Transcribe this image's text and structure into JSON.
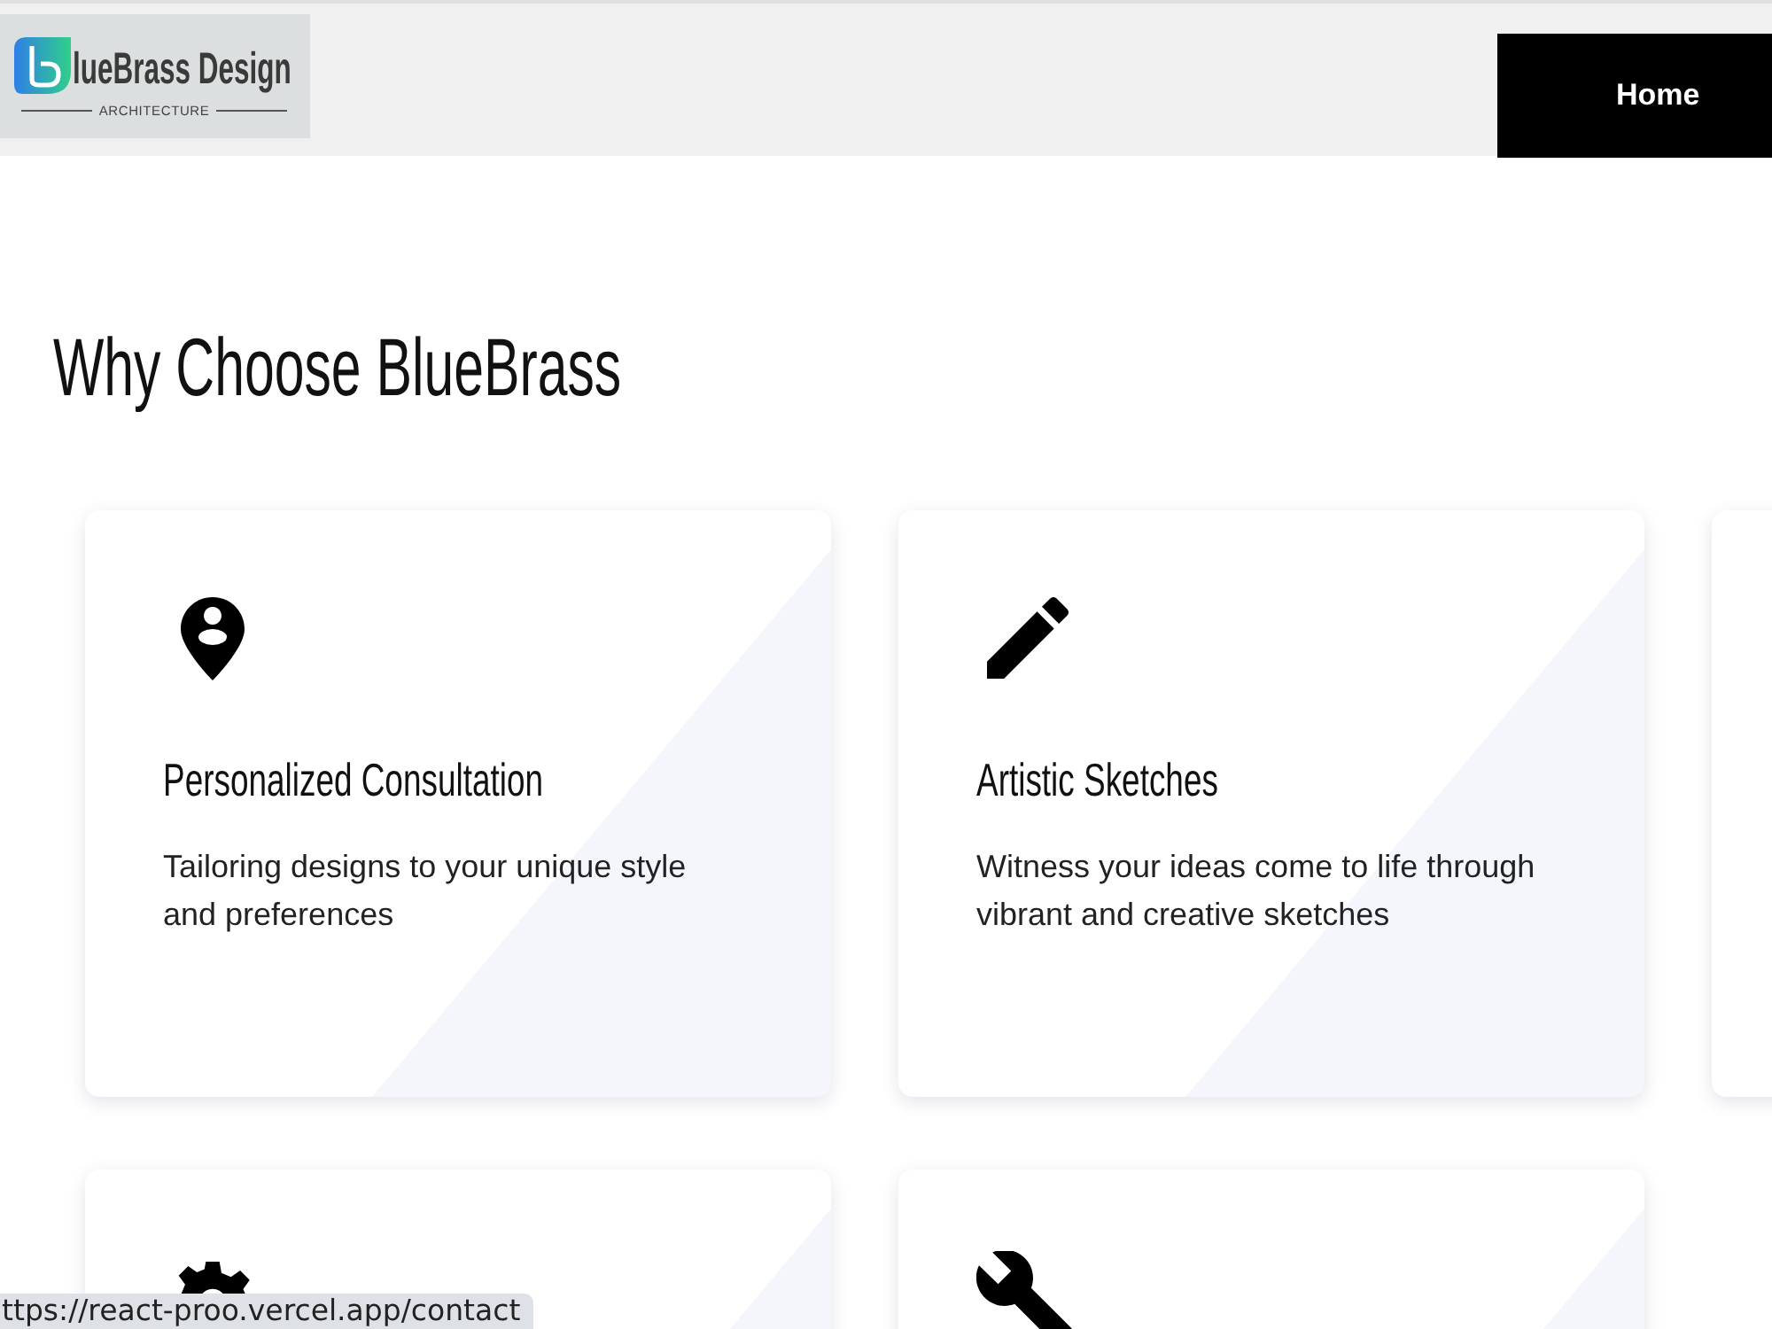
{
  "header": {
    "logo": {
      "name": "lueBrass Design",
      "tagline": "ARCHITECTURE"
    },
    "nav_items": [
      "Home"
    ]
  },
  "section": {
    "title": "Why Choose BlueBrass",
    "cards": [
      {
        "kind": "pin",
        "title": "Personalized Consultation",
        "description": "Tailoring designs to your unique style and preferences"
      },
      {
        "kind": "pencil",
        "title": "Artistic Sketches",
        "description": "Witness your ideas come to life through vibrant and creative sketches"
      },
      {
        "kind": "blank"
      },
      {
        "kind": "gear"
      },
      {
        "kind": "wrench"
      }
    ]
  },
  "status_bar": {
    "url": "ttps://react-proo.vercel.app/contact"
  }
}
